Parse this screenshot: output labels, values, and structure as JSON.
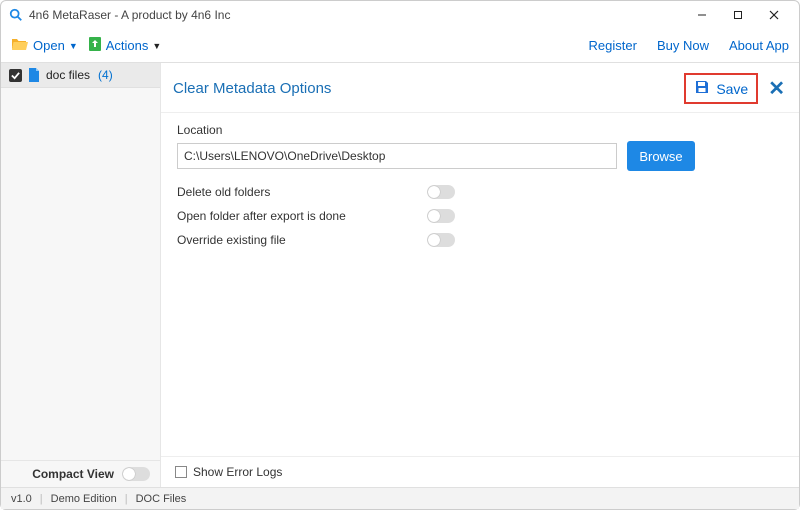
{
  "window": {
    "title": "4n6 MetaRaser - A product by 4n6 Inc"
  },
  "toolbar": {
    "open_label": "Open",
    "actions_label": "Actions",
    "links": {
      "register": "Register",
      "buy_now": "Buy Now",
      "about": "About App"
    }
  },
  "sidebar": {
    "item": {
      "label": "doc files",
      "count": "(4)"
    },
    "compact_label": "Compact View"
  },
  "panel": {
    "title": "Clear Metadata Options",
    "save_label": "Save",
    "location_label": "Location",
    "location_value": "C:\\Users\\LENOVO\\OneDrive\\Desktop",
    "browse_label": "Browse",
    "options": {
      "delete_old": "Delete old folders",
      "open_after": "Open folder after export is done",
      "override": "Override existing file"
    },
    "show_error_logs": "Show Error Logs"
  },
  "status": {
    "version": "v1.0",
    "edition": "Demo Edition",
    "files": "DOC Files"
  }
}
